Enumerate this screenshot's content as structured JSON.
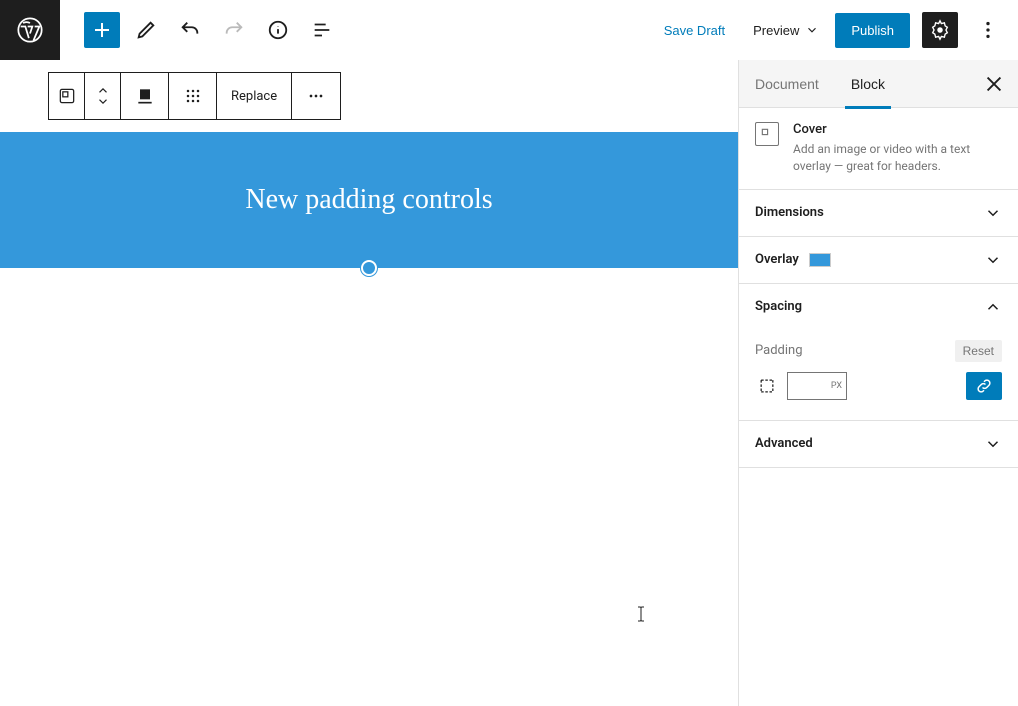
{
  "topbar": {
    "save_draft": "Save Draft",
    "preview": "Preview",
    "publish": "Publish"
  },
  "toolbar": {
    "replace": "Replace"
  },
  "cover": {
    "text": "New padding controls",
    "overlay_color": "#3498db"
  },
  "sidebar": {
    "tabs": {
      "document": "Document",
      "block": "Block"
    },
    "block_info": {
      "name": "Cover",
      "desc": "Add an image or video with a text overlay — great for headers."
    },
    "panels": {
      "dimensions": "Dimensions",
      "overlay": "Overlay",
      "spacing": "Spacing",
      "advanced": "Advanced"
    },
    "spacing": {
      "padding_label": "Padding",
      "reset": "Reset",
      "unit": "PX"
    }
  }
}
